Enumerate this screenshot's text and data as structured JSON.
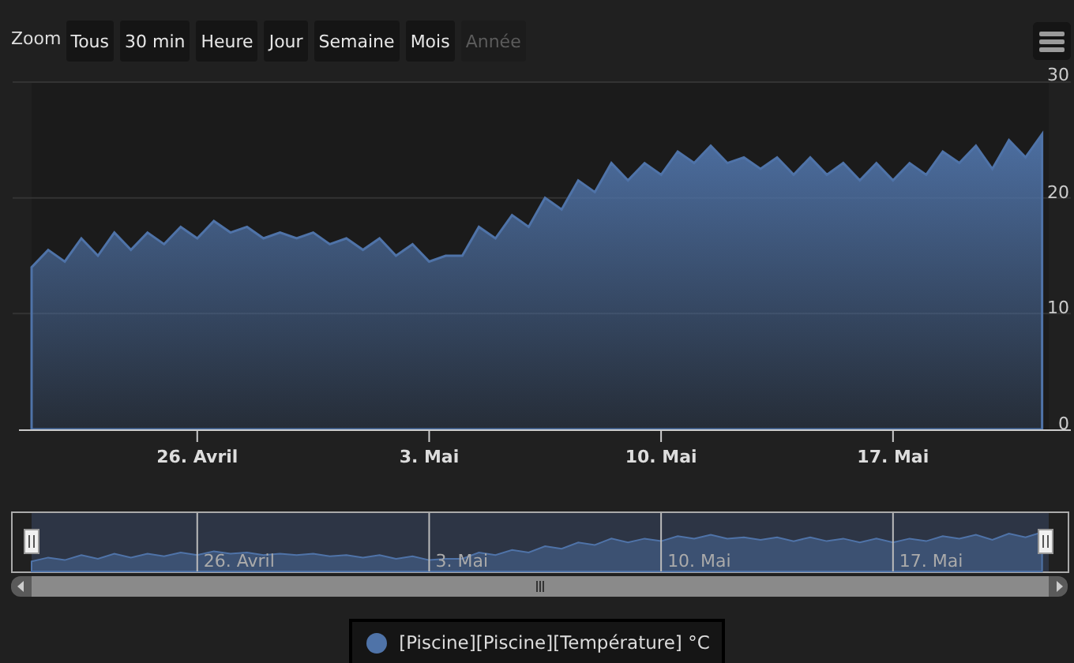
{
  "toolbar": {
    "zoom_label": "Zoom",
    "buttons": [
      {
        "label": "Tous",
        "disabled": false
      },
      {
        "label": "30 min",
        "disabled": false
      },
      {
        "label": "Heure",
        "disabled": false
      },
      {
        "label": "Jour",
        "disabled": false
      },
      {
        "label": "Semaine",
        "disabled": false
      },
      {
        "label": "Mois",
        "disabled": false
      },
      {
        "label": "Année",
        "disabled": true
      }
    ]
  },
  "chart": {
    "chart_data": {
      "type": "area",
      "ylim": [
        0,
        30
      ],
      "yticks": [
        0,
        10,
        20,
        30
      ],
      "categories": [
        null,
        null,
        null,
        null,
        null,
        null,
        null,
        null,
        null,
        null,
        "26. Avril",
        null,
        null,
        null,
        null,
        null,
        null,
        null,
        null,
        null,
        null,
        null,
        null,
        null,
        "3. Mai",
        null,
        null,
        null,
        null,
        null,
        null,
        null,
        null,
        null,
        null,
        null,
        null,
        null,
        "10. Mai",
        null,
        null,
        null,
        null,
        null,
        null,
        null,
        null,
        null,
        null,
        null,
        null,
        null,
        "17. Mai",
        null,
        null,
        null,
        null,
        null,
        null,
        null,
        null,
        null
      ],
      "series": [
        {
          "name": "[Piscine][Piscine][Température] °C",
          "color": "#4f73a8",
          "values": [
            14,
            15.5,
            14.5,
            16.5,
            15,
            17,
            15.5,
            17,
            16,
            17.5,
            16.5,
            18,
            17,
            17.5,
            16.5,
            17,
            16.5,
            17,
            16,
            16.5,
            15.5,
            16.5,
            15,
            16,
            14.5,
            15,
            15,
            17.5,
            16.5,
            18.5,
            17.5,
            20,
            19,
            21.5,
            20.5,
            23,
            21.5,
            23,
            22,
            24,
            23,
            24.5,
            23,
            23.5,
            22.5,
            23.5,
            22,
            23.5,
            22,
            23,
            21.5,
            23,
            21.5,
            23,
            22,
            24,
            23,
            24.5,
            22.5,
            25,
            23.5,
            25.5
          ]
        }
      ]
    }
  },
  "navigator": {
    "labels": [
      "26. Avril",
      "3. Mai",
      "10. Mai",
      "17. Mai"
    ]
  }
}
